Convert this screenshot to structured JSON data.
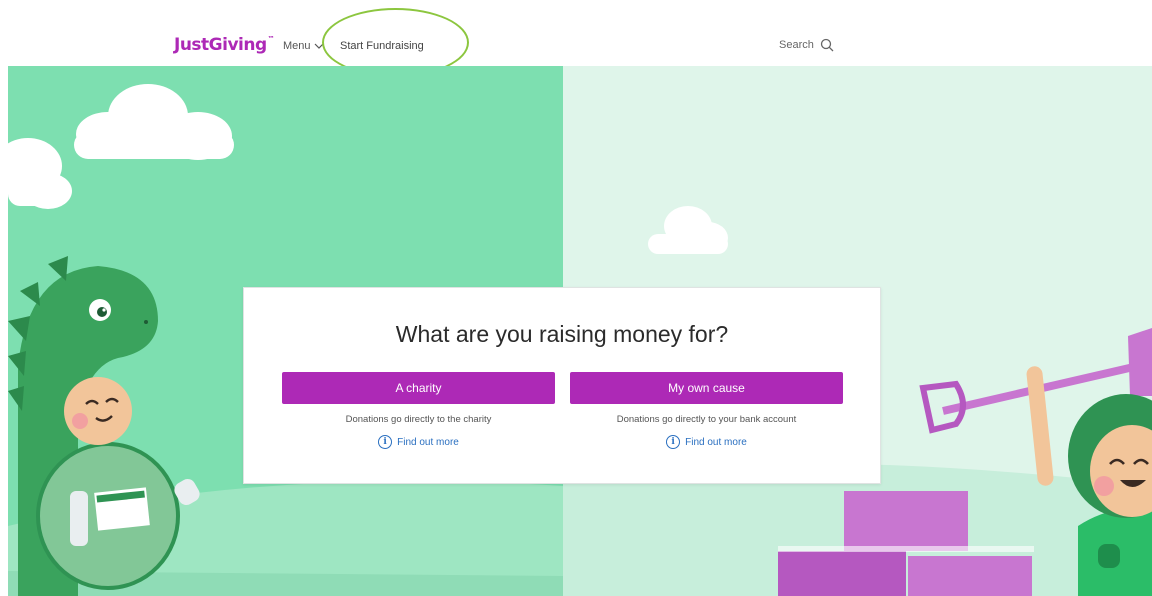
{
  "header": {
    "logo": "JustGiving",
    "logo_tm": "™",
    "menu_label": "Menu",
    "start_link": "Start Fundraising",
    "search_label": "Search"
  },
  "card": {
    "title": "What are you raising money for?",
    "options": [
      {
        "button_label": "A charity",
        "description": "Donations go directly to the charity",
        "link": "Find out more"
      },
      {
        "button_label": "My own cause",
        "description": "Donations go directly to your bank account",
        "link": "Find out more"
      }
    ]
  },
  "colors": {
    "brand": "#ad29b6",
    "left_panel": "#7ddfb0",
    "right_panel": "#dff5ea",
    "link": "#2a6fc0",
    "highlight": "#8cc63f"
  },
  "icons": {
    "menu": "chevron-down-icon",
    "search": "search-icon",
    "info": "info-icon"
  }
}
